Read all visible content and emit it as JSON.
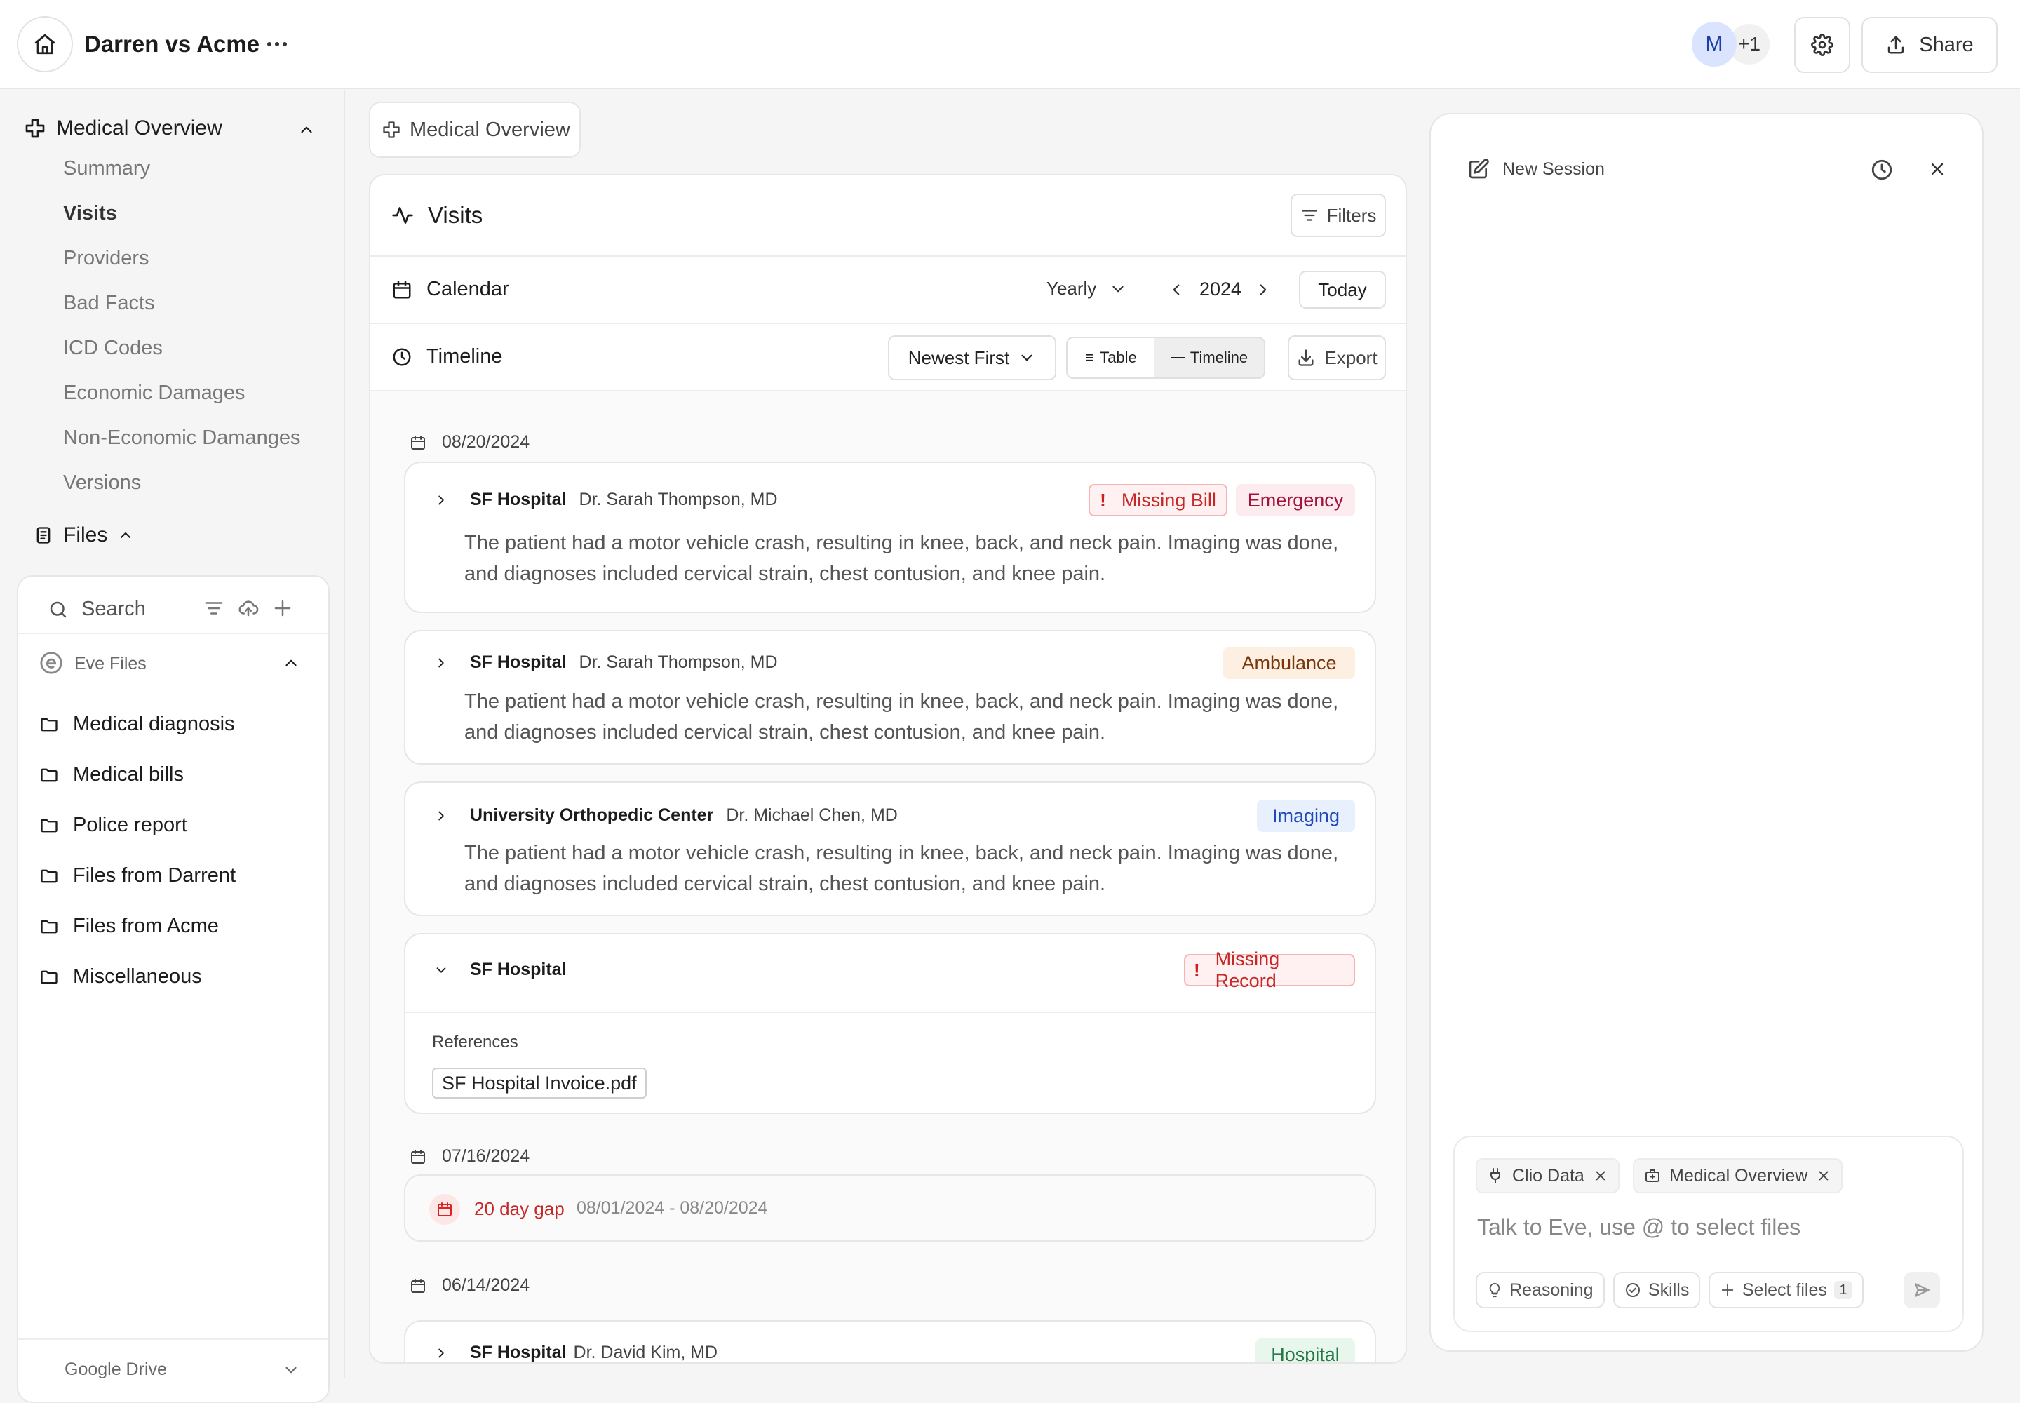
{
  "header": {
    "title": "Darren vs Acme",
    "avatar_initial": "M",
    "avatar_extra": "+1",
    "share_label": "Share"
  },
  "sidebar": {
    "section_title": "Medical Overview",
    "items": [
      {
        "label": "Summary",
        "active": false
      },
      {
        "label": "Visits",
        "active": true
      },
      {
        "label": "Providers",
        "active": false
      },
      {
        "label": "Bad Facts",
        "active": false
      },
      {
        "label": "ICD Codes",
        "active": false
      },
      {
        "label": "Economic Damages",
        "active": false
      },
      {
        "label": "Non-Economic Damanges",
        "active": false
      },
      {
        "label": "Versions",
        "active": false
      }
    ],
    "files_title": "Files",
    "search_placeholder": "Search",
    "eve_files_label": "Eve Files",
    "folders": [
      "Medical diagnosis",
      "Medical bills",
      "Police report",
      "Files from Darrent",
      "Files from Acme",
      "Miscellaneous"
    ],
    "google_drive_label": "Google Drive"
  },
  "main": {
    "breadcrumb": "Medical Overview",
    "visits_title": "Visits",
    "filters_label": "Filters",
    "calendar_title": "Calendar",
    "period": "Yearly",
    "year": "2024",
    "today_label": "Today",
    "timeline_title": "Timeline",
    "sort_label": "Newest First",
    "view_table": "Table",
    "view_timeline": "Timeline",
    "export_label": "Export",
    "dates": [
      "08/20/2024",
      "07/16/2024",
      "06/14/2024"
    ],
    "visits": [
      {
        "hospital": "SF Hospital",
        "doctor": "Dr. Sarah Thompson, MD",
        "flag": "Missing Bill",
        "category": "Emergency",
        "text": "The patient had a motor vehicle crash, resulting in knee, back, and neck pain. Imaging was done, and diagnoses included cervical strain, chest contusion, and knee pain."
      },
      {
        "hospital": "SF Hospital",
        "doctor": "Dr. Sarah Thompson, MD",
        "category": "Ambulance",
        "text": "The patient had a motor vehicle crash, resulting in knee, back, and neck pain. Imaging was done, and diagnoses included cervical strain, chest contusion, and knee pain."
      },
      {
        "hospital": "University Orthopedic Center",
        "doctor": "Dr. Michael Chen, MD",
        "category": "Imaging",
        "text": "The patient had a motor vehicle crash, resulting in knee, back, and neck pain. Imaging was done, and diagnoses included cervical strain, chest contusion, and knee pain."
      }
    ],
    "missing_record": {
      "hospital": "SF Hospital",
      "flag": "Missing Record",
      "references_label": "References",
      "file": "SF Hospital Invoice.pdf"
    },
    "gap": {
      "label": "20 day gap",
      "range": "08/01/2024 - 08/20/2024"
    },
    "last_visit": {
      "hospital": "SF Hospital",
      "doctor": "Dr. David Kim, MD",
      "category": "Hospital"
    }
  },
  "chat": {
    "new_session_label": "New Session",
    "context_chips": [
      "Clio Data",
      "Medical Overview"
    ],
    "input_placeholder": "Talk to Eve, use @ to select files",
    "reasoning_label": "Reasoning",
    "skills_label": "Skills",
    "select_files_label": "Select files",
    "select_files_count": "1"
  },
  "colors": {
    "missing": "#c62828",
    "emergency": "#a3123e",
    "ambulance": "#7a3608",
    "imaging": "#2048b8",
    "hospital": "#26774a",
    "avatar": "#dbe4ff"
  }
}
